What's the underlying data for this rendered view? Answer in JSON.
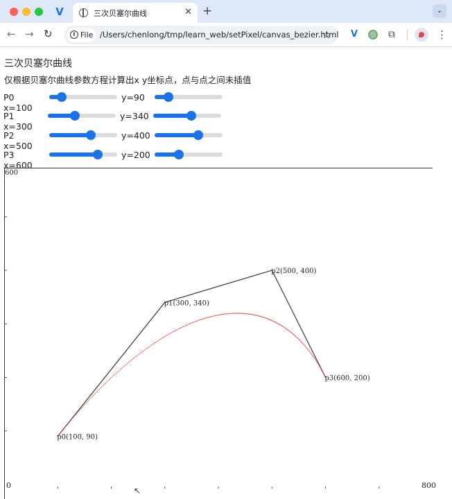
{
  "browser": {
    "tab_title": "三次贝塞尔曲线",
    "tab_close": "✕",
    "new_tab": "+",
    "tab_menu": "⌄",
    "pinned_tab_icon": "V",
    "url_chip": "File",
    "url": "/Users/chenlong/tmp/learn_web/setPixel/canvas_bezier.html",
    "back": "←",
    "forward": "→",
    "reload": "↻",
    "bookmark_star": "☆",
    "ext_v": "V",
    "ext_puzzle": "⧉",
    "menu": "⋮",
    "colors": {
      "frame": "#dfe8f7",
      "accent": "#1a73e8"
    }
  },
  "page": {
    "heading": "三次贝塞尔曲线",
    "description": "仅根据贝塞尔曲线参数方程计算出x y坐标点，点与点之间未插值",
    "controls": [
      {
        "xlabel": "P0 x=100",
        "ylabel": "y=90",
        "x": 100,
        "y": 90
      },
      {
        "xlabel": "P1 x=300",
        "ylabel": "y=340",
        "x": 300,
        "y": 340
      },
      {
        "xlabel": "P2 x=500",
        "ylabel": "y=400",
        "x": 500,
        "y": 400
      },
      {
        "xlabel": "P3 x=600",
        "ylabel": "y=200",
        "x": 600,
        "y": 200
      }
    ],
    "slider_max": {
      "x": 800,
      "y": 600
    }
  },
  "chart_data": {
    "type": "line",
    "points": [
      {
        "label": "p0(100, 90)",
        "x": 100,
        "y": 90
      },
      {
        "label": "p1(300, 340)",
        "x": 300,
        "y": 340
      },
      {
        "label": "p2(500, 400)",
        "x": 500,
        "y": 400
      },
      {
        "label": "p3(600, 200)",
        "x": 600,
        "y": 200
      }
    ],
    "x_range": [
      0,
      800
    ],
    "y_range": [
      0,
      600
    ],
    "axis_labels": {
      "origin": "0",
      "x_max": "800",
      "y_max": "600"
    },
    "colors": {
      "curve": "#e53935",
      "control": "#444444"
    }
  }
}
